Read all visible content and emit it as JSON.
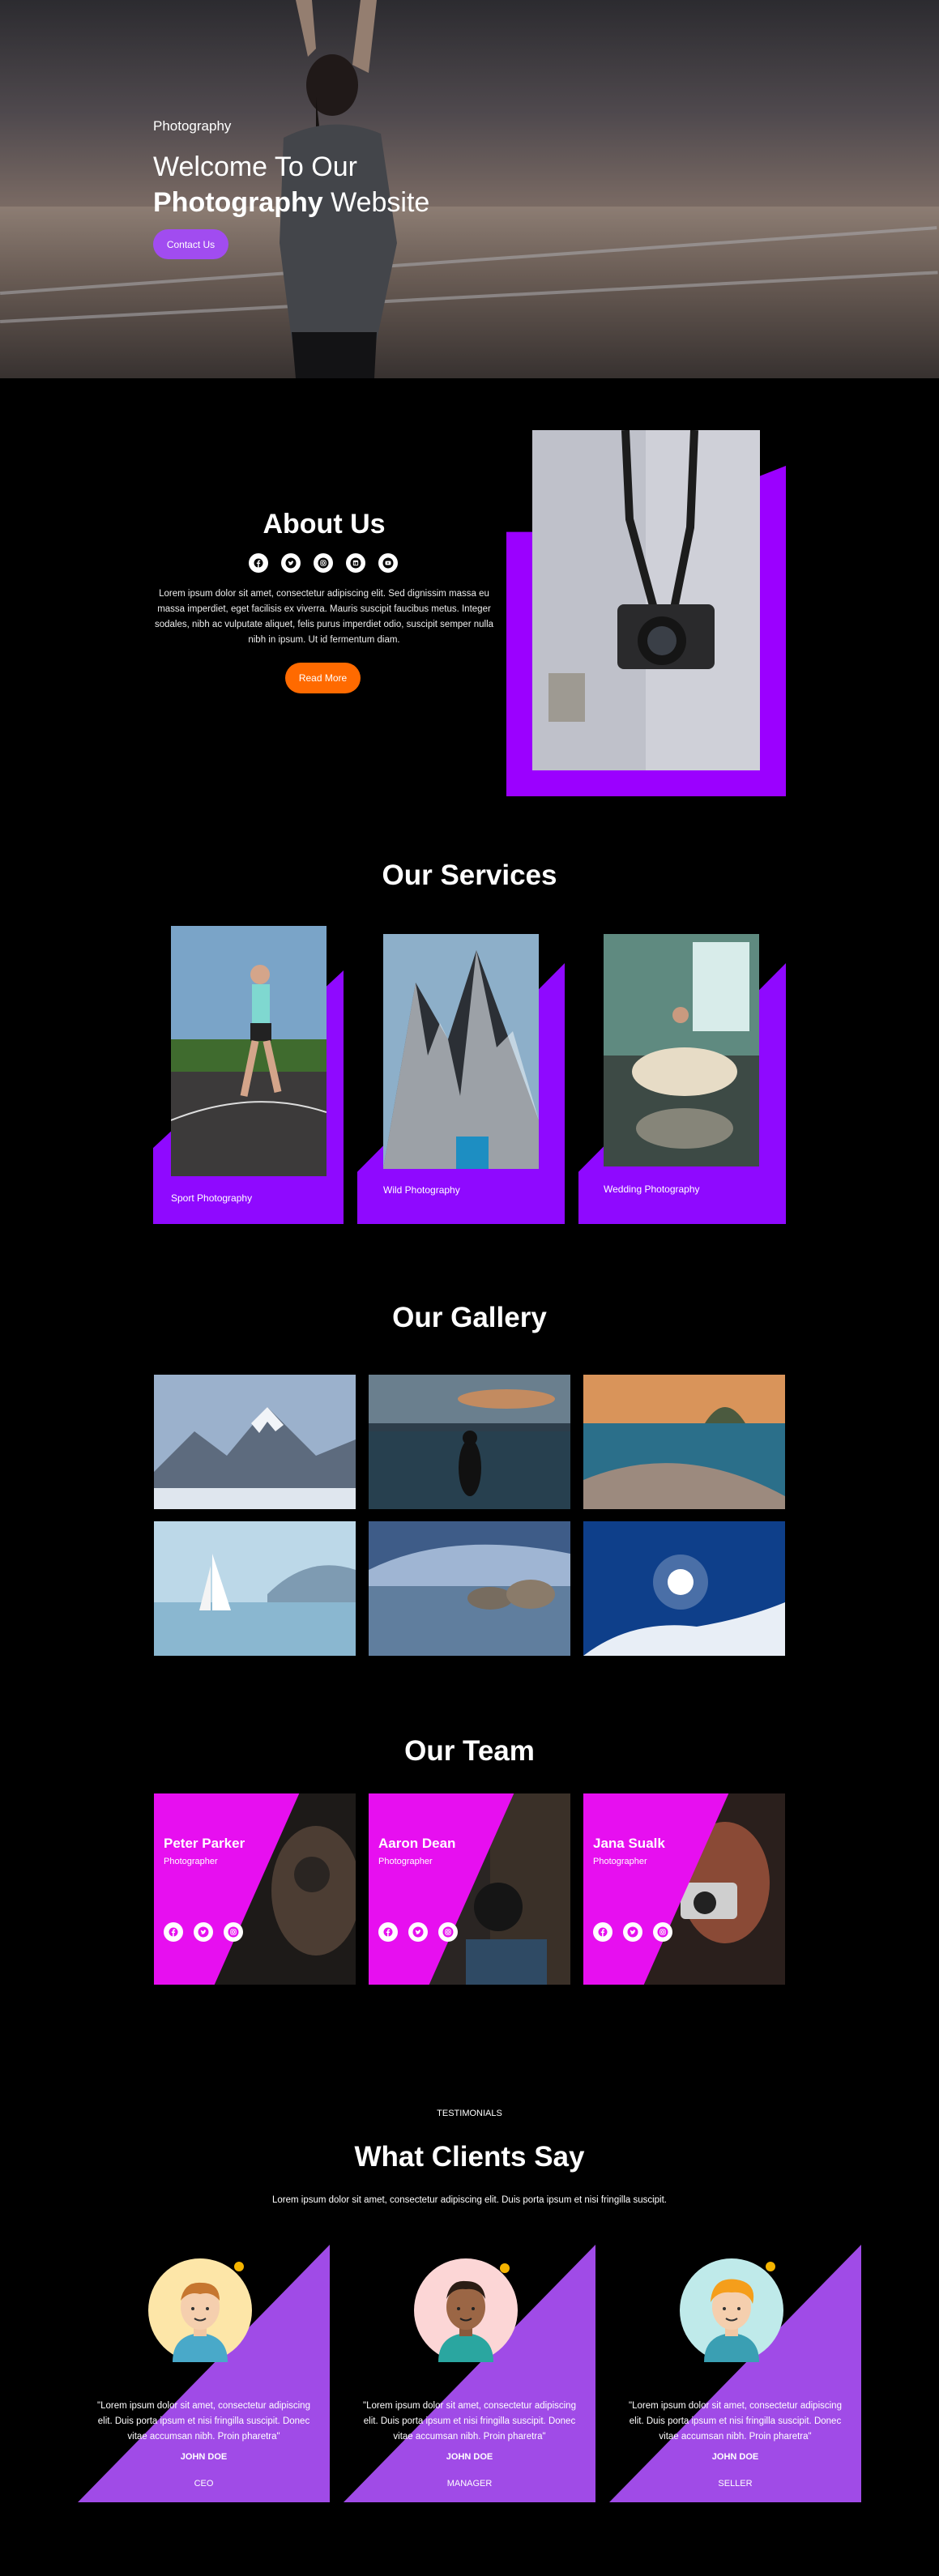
{
  "hero": {
    "kicker": "Photography",
    "title_line1": "Welcome To Our",
    "title_bold": "Photography",
    "title_rest": " Website",
    "button": "Contact Us"
  },
  "about": {
    "title": "About Us",
    "social_icons": [
      "facebook-icon",
      "twitter-icon",
      "instagram-icon",
      "linkedin-icon",
      "youtube-icon"
    ],
    "text": "Lorem ipsum dolor sit amet, consectetur adipiscing elit. Sed dignissim massa eu massa imperdiet, eget facilisis ex viverra. Mauris suscipit faucibus metus. Integer sodales, nibh ac vulputate aliquet, felis purus imperdiet odio, suscipit semper nulla nibh in ipsum. Ut id fermentum diam.",
    "button": "Read More"
  },
  "services": {
    "title": "Our Services",
    "items": [
      {
        "label": "Sport Photography"
      },
      {
        "label": "Wild Photography"
      },
      {
        "label": "Wedding Photography"
      }
    ]
  },
  "gallery": {
    "title": "Our Gallery",
    "images": [
      "mountains",
      "lake-man",
      "coast-city",
      "sailboat",
      "rocks-lake",
      "skier-sky"
    ]
  },
  "team": {
    "title": "Our Team",
    "members": [
      {
        "name": "Peter Parker",
        "role": "Photographer"
      },
      {
        "name": "Aaron Dean",
        "role": "Photographer"
      },
      {
        "name": "Jana Sualk",
        "role": "Photographer"
      }
    ]
  },
  "testimonials": {
    "kicker": "TESTIMONIALS",
    "title": "What Clients Say",
    "subtitle": "Lorem ipsum dolor sit amet, consectetur adipiscing elit. Duis porta ipsum et nisi fringilla suscipit.",
    "items": [
      {
        "quote": "\"Lorem ipsum dolor sit amet, consectetur adipiscing elit. Duis porta ipsum et nisi fringilla suscipit. Donec vitae accumsan nibh. Proin pharetra\"",
        "name": "JOHN DOE",
        "role": "CEO"
      },
      {
        "quote": "\"Lorem ipsum dolor sit amet, consectetur adipiscing elit. Duis porta ipsum et nisi fringilla suscipit. Donec vitae accumsan nibh. Proin pharetra\"",
        "name": "JOHN DOE",
        "role": "MANAGER"
      },
      {
        "quote": "\"Lorem ipsum dolor sit amet, consectetur adipiscing elit. Duis porta ipsum et nisi fringilla suscipit. Donec vitae accumsan nibh. Proin pharetra\"",
        "name": "JOHN DOE",
        "role": "SELLER"
      }
    ]
  },
  "colors": {
    "accent_purple": "#8f09ff",
    "button_purple": "#a14cf0",
    "orange": "#ff6a00",
    "team_pink": "#e70ff0",
    "testimonial_purple": "#a04be7"
  }
}
